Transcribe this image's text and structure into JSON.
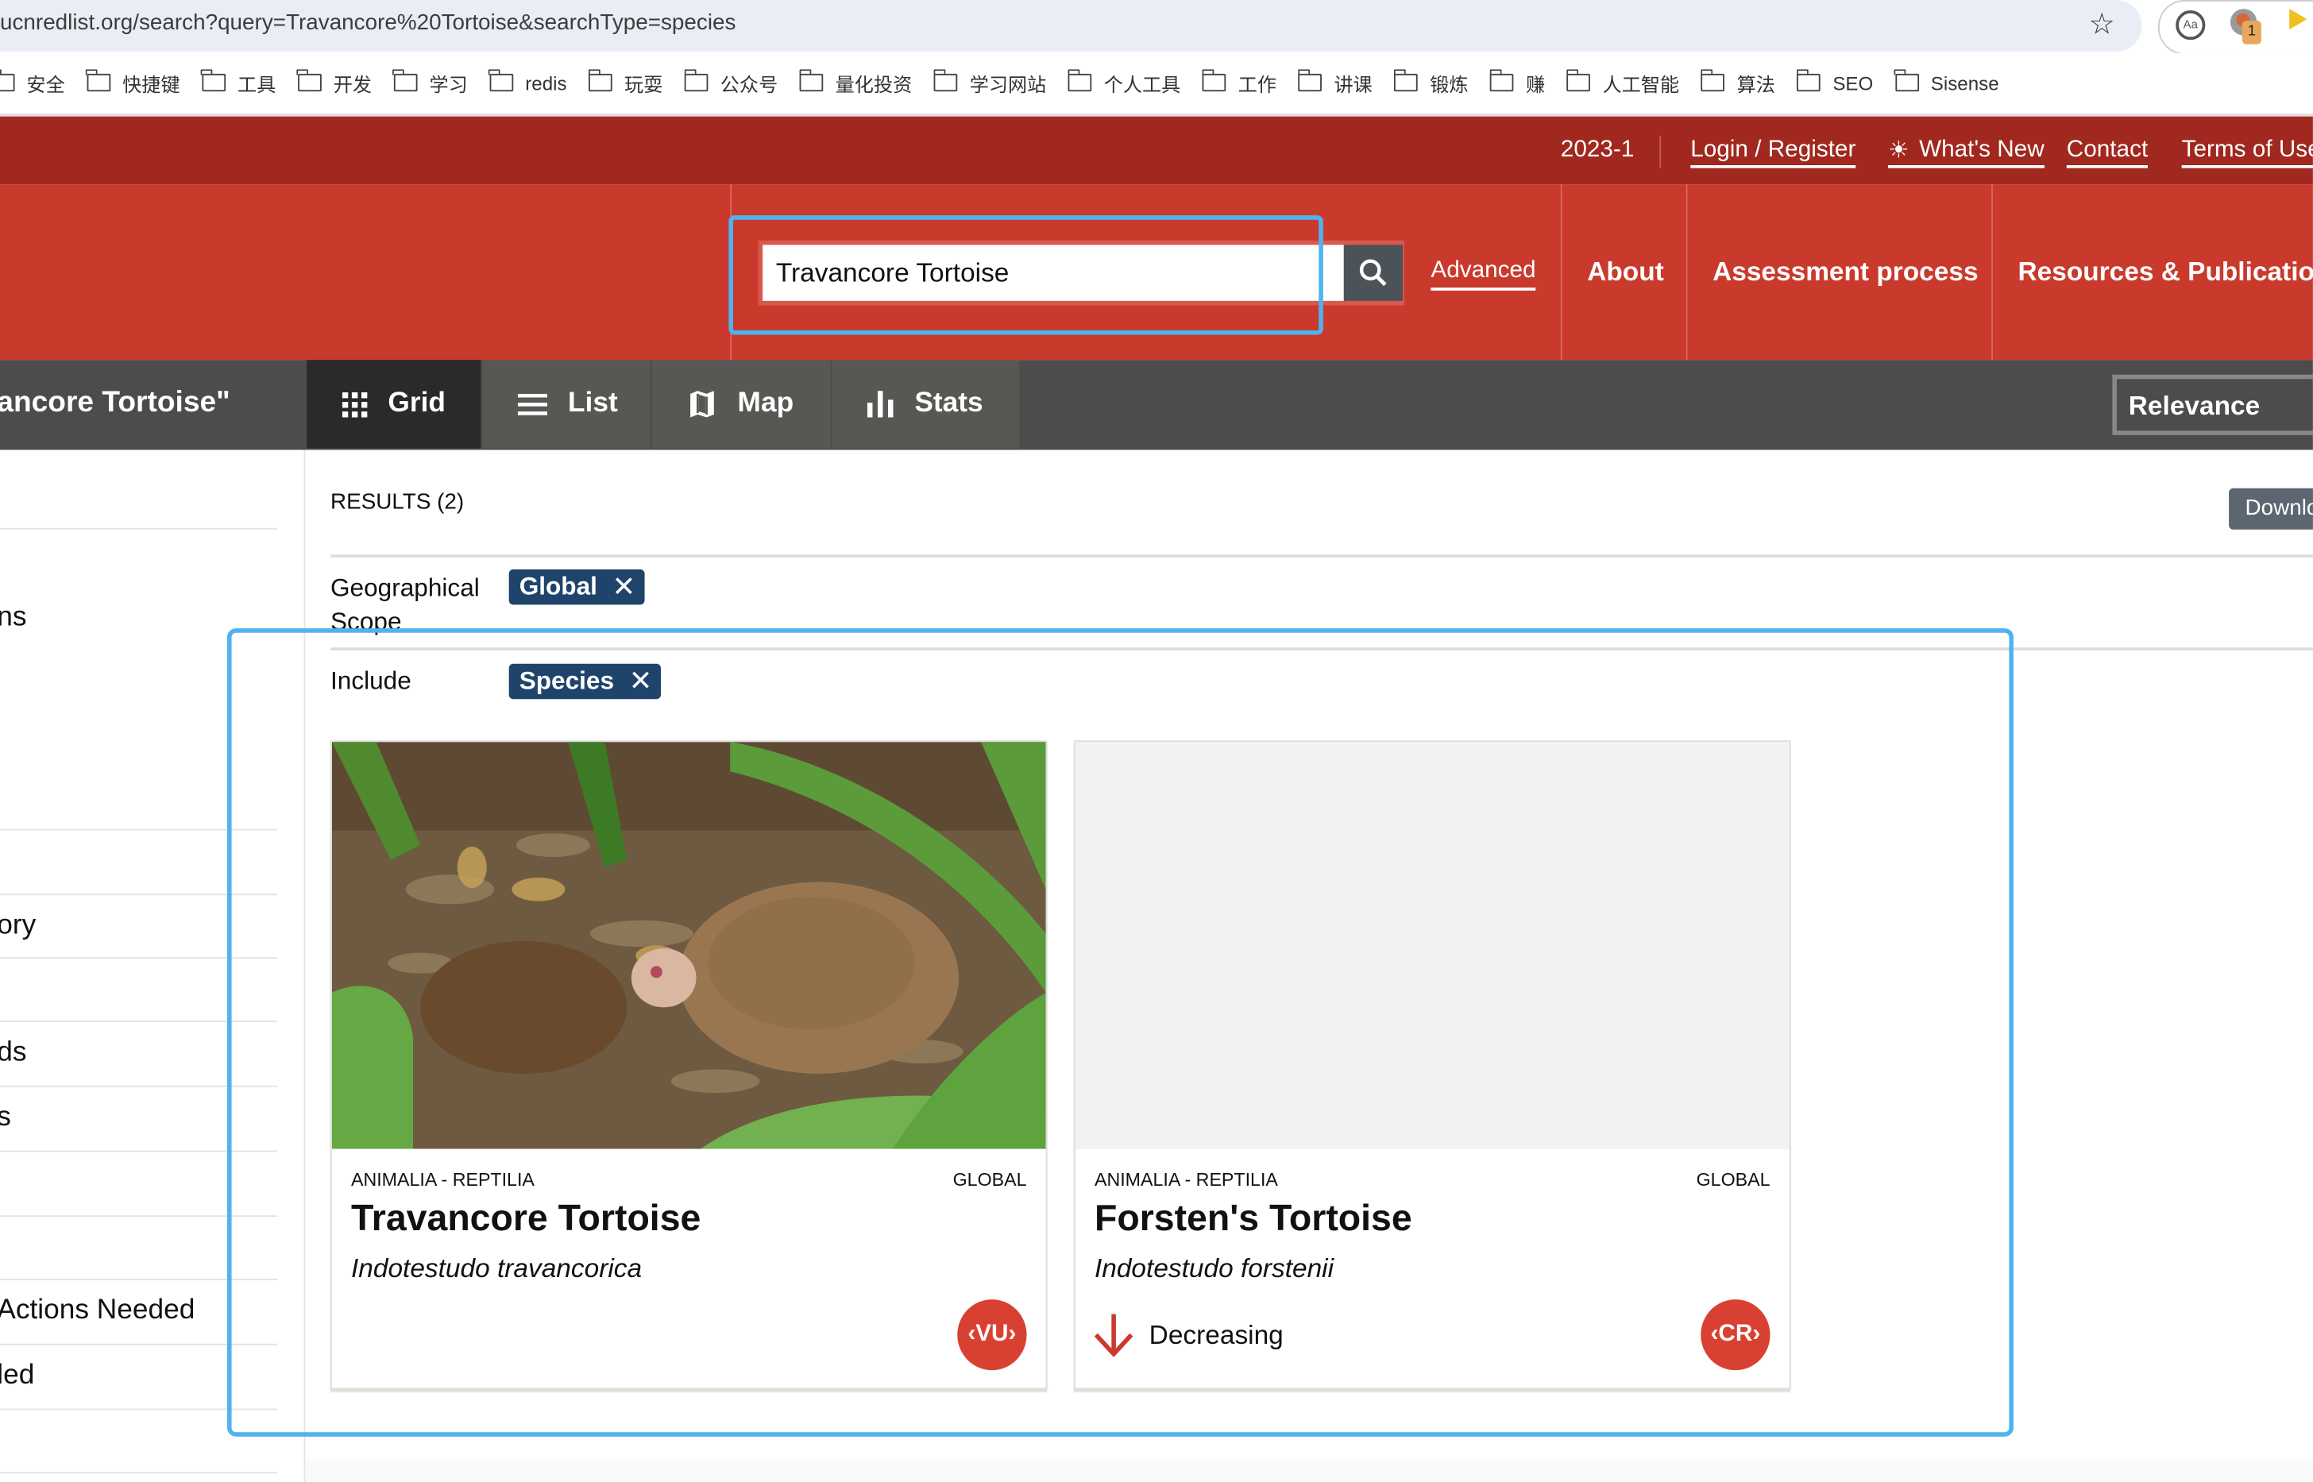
{
  "browser": {
    "url": "ucnredlist.org/search?query=Travancore%20Tortoise&searchType=species",
    "extension_badge_count": "1",
    "bookmarks": [
      "安全",
      "快捷键",
      "工具",
      "开发",
      "学习",
      "redis",
      "玩耍",
      "公众号",
      "量化投资",
      "学习网站",
      "个人工具",
      "工作",
      "讲课",
      "锻炼",
      "赚",
      "人工智能",
      "算法",
      "SEO",
      "Sisense"
    ]
  },
  "topbar": {
    "version": "2023-1",
    "links": [
      "Login / Register",
      "What's New",
      "Contact",
      "Terms of Use"
    ]
  },
  "header": {
    "search_value": "Travancore Tortoise",
    "advanced_label": "Advanced",
    "nav": [
      "About",
      "Assessment process",
      "Resources & Publications"
    ]
  },
  "toolbar": {
    "query_title": "ancore Tortoise\"",
    "tabs": [
      {
        "label": "Grid",
        "icon": "grid-icon",
        "active": true
      },
      {
        "label": "List",
        "icon": "list-icon",
        "active": false
      },
      {
        "label": "Map",
        "icon": "map-icon",
        "active": false
      },
      {
        "label": "Stats",
        "icon": "bar-chart-icon",
        "active": false
      }
    ],
    "sort_value": "Relevance"
  },
  "sidebar": {
    "items": [
      "ns",
      "ory",
      "ds",
      "s",
      "Actions Needed",
      "led"
    ]
  },
  "results": {
    "count_label": "RESULTS (2)",
    "download_label": "Downlo",
    "filters": [
      {
        "label": "Geographical Scope",
        "chip": "Global"
      },
      {
        "label": "Include",
        "chip": "Species"
      }
    ],
    "cards": [
      {
        "kingdom": "ANIMALIA - REPTILIA",
        "scope": "GLOBAL",
        "common_name": "Travancore Tortoise",
        "scientific_name": "Indotestudo travancorica",
        "trend": "",
        "category": "VU",
        "has_image": true
      },
      {
        "kingdom": "ANIMALIA - REPTILIA",
        "scope": "GLOBAL",
        "common_name": "Forsten's Tortoise",
        "scientific_name": "Indotestudo forstenii",
        "trend": "Decreasing",
        "category": "CR",
        "has_image": false
      }
    ]
  },
  "colors": {
    "topbar": "#a0281e",
    "header": "#c93a2d",
    "tabbar": "#4e4c4a",
    "chip": "#1f446b",
    "category_badge": "#d84132",
    "highlight": "#4fb3f0"
  }
}
